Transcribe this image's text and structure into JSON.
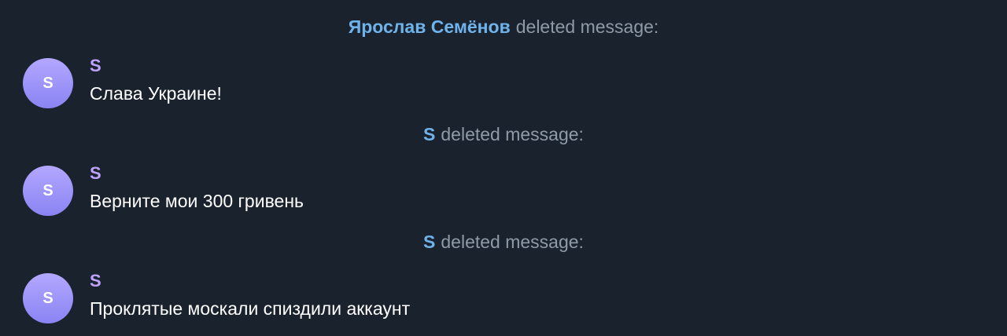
{
  "feed": [
    {
      "kind": "event",
      "actor": "Ярослав Семёнов",
      "action": "deleted message:"
    },
    {
      "kind": "message",
      "avatar_letter": "S",
      "sender": "S",
      "text": "Слава Украине!"
    },
    {
      "kind": "event",
      "actor": "S",
      "action": "deleted message:"
    },
    {
      "kind": "message",
      "avatar_letter": "S",
      "sender": "S",
      "text": "Верните мои 300 гривень"
    },
    {
      "kind": "event",
      "actor": "S",
      "action": "deleted message:"
    },
    {
      "kind": "message",
      "avatar_letter": "S",
      "sender": "S",
      "text": "Проклятые москали спиздили аккаунт"
    }
  ],
  "colors": {
    "background": "#1a222e",
    "event_actor": "#6fb3ea",
    "event_text": "#8f9aa6",
    "sender_name": "#bfa3ff",
    "avatar_gradient_top": "#b3a7ff",
    "avatar_gradient_bottom": "#8a84f3",
    "message_text": "#ffffff"
  }
}
